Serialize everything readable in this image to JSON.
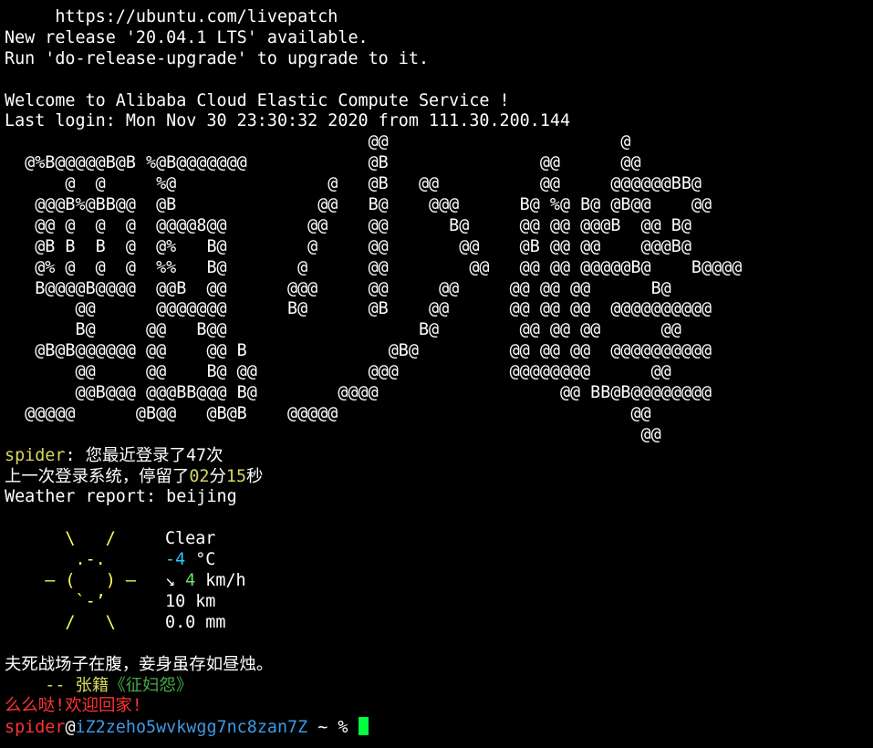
{
  "motd": {
    "livepatch_url": "     https://ubuntu.com/livepatch",
    "release_notice": "New release '20.04.1 LTS' available.",
    "upgrade_hint": "Run 'do-release-upgrade' to upgrade to it.",
    "welcome": "Welcome to Alibaba Cloud Elastic Compute Service !",
    "last_login": "Last login: Mon Nov 30 23:30:32 2020 from 111.30.200.144"
  },
  "ascii_art": [
    "                                    @@                       @",
    "  @%B@@@@@B@B %@B@@@@@@@            @B               @@      @@",
    "      @  @     %@               @   @B   @@          @@     @@@@@@BB@",
    "   @@@B%@BB@@  @B              @@   B@    @@@      B@ %@ B@ @B@@    @@",
    "   @@ @  @  @  @@@@8@@        @@    @@      B@     @@ @@ @@@B  @@ B@",
    "   @B B  B  @  @%   B@        @     @@       @@    @B @@ @@    @@@B@",
    "   @% @  @  @  %%   B@       @      @@        @@   @@ @@ @@@@@B@    B@@@@",
    "   B@@@@B@@@@  @@B  @@      @@@     @@     @@     @@ @@ @@      B@",
    "       @@      @@@@@@@      B@      @B    @@      @@ @@ @@  @@@@@@@@@@",
    "       B@     @@   B@@                   B@        @@ @@ @@      @@",
    "   @B@B@@@@@@ @@    @@ B              @B@         @@ @@ @@  @@@@@@@@@@",
    "       @@     @@    B@ @@           @@@           @@@@@@@@      @@",
    "       @@B@@@ @@@BB@@@ B@        @@@@                  @@ BB@B@@@@@@@@",
    "  @@@@@      @B@@   @B@B    @@@@@                             @@",
    "                                                               @@"
  ],
  "greeting": {
    "user": "spider",
    "sep": ": ",
    "login_count_prefix": "您最近登录了",
    "login_count": "47",
    "login_count_suffix": "次",
    "stay_prefix": "上一次登录系统，停留了",
    "stay_minutes": "02",
    "stay_minutes_unit": "分",
    "stay_seconds": "15",
    "stay_seconds_unit": "秒"
  },
  "weather": {
    "report_label": "Weather report: beijing",
    "icon_lines": [
      "      \\   /     ",
      "       .-.      ",
      "    ― (   ) ―   ",
      "       `-’      ",
      "      /   \\     "
    ],
    "condition": "Clear",
    "temperature": "-4",
    "temperature_unit": " °C",
    "wind_arrow": "↘ ",
    "wind_speed": "4",
    "wind_unit": " km/h",
    "visibility": "10 km",
    "precipitation": "0.0 mm"
  },
  "poem": {
    "text": "夫死战场子在腹，妾身虽存如昼烛。",
    "dash": "    -- ",
    "author": "张籍",
    "title": "《征妇怨》"
  },
  "farewell": "么么哒!欢迎回家!",
  "prompt": {
    "user": "spider",
    "at": "@",
    "host": "iZ2zeho5wvkwgg7nc8zan7Z",
    "path": " ~ ",
    "symbol": "% "
  },
  "colors": {
    "background": "#000000",
    "foreground": "#ffffff",
    "yellow": "#d7d75f",
    "cyan": "#28c8ff",
    "green": "#6ce36c",
    "red": "#ff3333",
    "blue": "#3d9ae6",
    "cursor": "#00ff3c"
  }
}
